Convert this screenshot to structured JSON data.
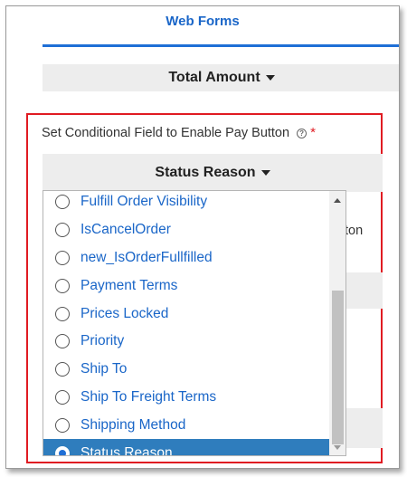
{
  "tab": {
    "label": "Web Forms"
  },
  "total_dropdown": {
    "label": "Total Amount"
  },
  "conditional_field": {
    "label": "Set Conditional Field to Enable Pay Button",
    "help_icon": "help-circle-icon",
    "required_mark": "*"
  },
  "status_dropdown": {
    "label": "Status Reason",
    "options": [
      {
        "label": "Fulfill Order Visibility",
        "selected": false
      },
      {
        "label": "IsCancelOrder",
        "selected": false
      },
      {
        "label": "new_IsOrderFullfilled",
        "selected": false
      },
      {
        "label": "Payment Terms",
        "selected": false
      },
      {
        "label": "Prices Locked",
        "selected": false
      },
      {
        "label": "Priority",
        "selected": false
      },
      {
        "label": "Ship To",
        "selected": false
      },
      {
        "label": "Ship To Freight Terms",
        "selected": false
      },
      {
        "label": "Shipping Method",
        "selected": false
      },
      {
        "label": "Status Reason",
        "selected": true
      }
    ]
  },
  "background": {
    "partial_text": "tton"
  },
  "colors": {
    "accent": "#1a66c8",
    "highlight": "#e01b22",
    "selected_bg": "#2f7dbd"
  }
}
